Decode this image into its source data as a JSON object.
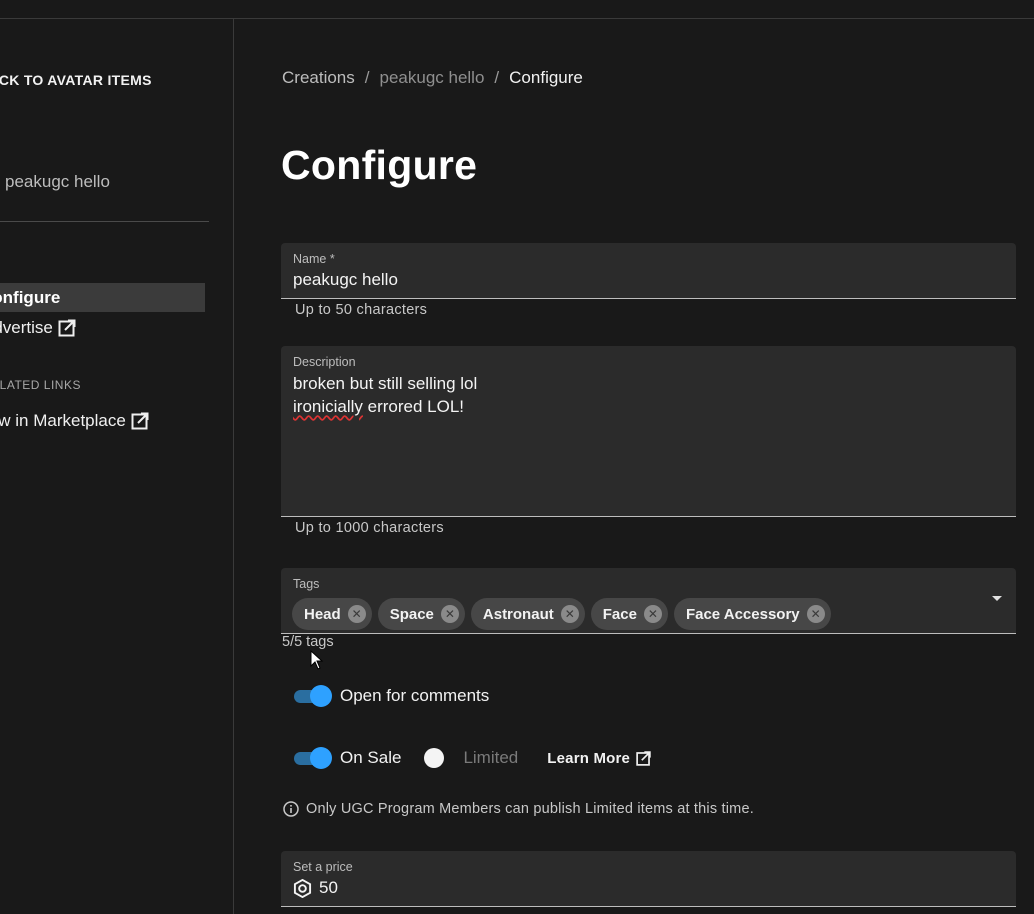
{
  "sidebar": {
    "back_label": "BACK TO AVATAR ITEMS",
    "item_name": "peakugc hello",
    "nav_configure": "Configure",
    "nav_advertise": "Advertise",
    "related_header": "RELATED LINKS",
    "view_marketplace": "View in Marketplace"
  },
  "breadcrumb": {
    "root": "Creations",
    "item": "peakugc hello",
    "current": "Configure",
    "separator": "/"
  },
  "page_title": "Configure",
  "form": {
    "name": {
      "label": "Name *",
      "value": "peakugc hello",
      "helper": "Up to 50 characters"
    },
    "description": {
      "label": "Description",
      "line1": "broken but still selling lol",
      "line2_misspelled": "ironicially",
      "line2_rest": " errored LOL!",
      "helper": "Up to 1000 characters"
    },
    "tags": {
      "label": "Tags",
      "items": [
        "Head",
        "Space",
        "Astronaut",
        "Face",
        "Face Accessory"
      ],
      "count": "5/5 tags"
    },
    "comments_toggle": {
      "label": "Open for comments",
      "on": true
    },
    "sale_toggle": {
      "label": "On Sale",
      "on": true
    },
    "limited_label": "Limited",
    "learn_more": "Learn More",
    "info_text": "Only UGC Program Members can publish Limited items at this time.",
    "price": {
      "label": "Set a price",
      "value": "50"
    }
  },
  "colors": {
    "accent": "#2ea1ff",
    "background": "#191919",
    "field": "#2b2b2b"
  }
}
